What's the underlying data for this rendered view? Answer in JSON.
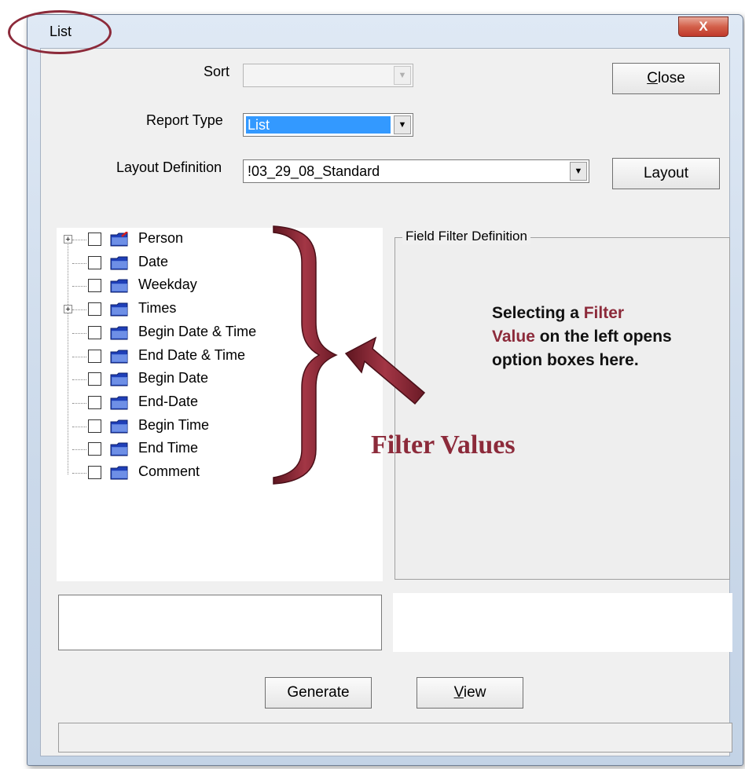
{
  "window": {
    "title": "List",
    "close_glyph": "X"
  },
  "sort": {
    "label": "Sort",
    "value": ""
  },
  "report_type": {
    "label": "Report Type",
    "value": "List"
  },
  "layout_definition": {
    "label": "Layout Definition",
    "value": "!03_29_08_Standard"
  },
  "buttons": {
    "close": {
      "prefix": "",
      "underline": "C",
      "rest": "lose"
    },
    "layout": "Layout",
    "generate": "Generate",
    "view": {
      "underline": "V",
      "rest": "iew"
    }
  },
  "tree": {
    "items": [
      {
        "label": "Person",
        "expandable": true,
        "icon": "folder-person-icon"
      },
      {
        "label": "Date",
        "expandable": false,
        "icon": "folder-icon"
      },
      {
        "label": "Weekday",
        "expandable": false,
        "icon": "folder-icon"
      },
      {
        "label": "Times",
        "expandable": true,
        "icon": "folder-icon"
      },
      {
        "label": "Begin Date & Time",
        "expandable": false,
        "icon": "folder-icon"
      },
      {
        "label": "End Date & Time",
        "expandable": false,
        "icon": "folder-icon"
      },
      {
        "label": "Begin Date",
        "expandable": false,
        "icon": "folder-icon"
      },
      {
        "label": "End-Date",
        "expandable": false,
        "icon": "folder-icon"
      },
      {
        "label": "Begin Time",
        "expandable": false,
        "icon": "folder-icon"
      },
      {
        "label": "End Time",
        "expandable": false,
        "icon": "folder-icon"
      },
      {
        "label": "Comment",
        "expandable": false,
        "icon": "folder-icon"
      }
    ]
  },
  "field_filter": {
    "title": "Field Filter Definition"
  },
  "annotation": {
    "note_part1": "Selecting a ",
    "note_hl1": "Filter",
    "note_hl2": "Value",
    "note_part2": " on the left opens option boxes here.",
    "filter_values_label": "Filter Values",
    "accent_color": "#8c2a3a"
  }
}
